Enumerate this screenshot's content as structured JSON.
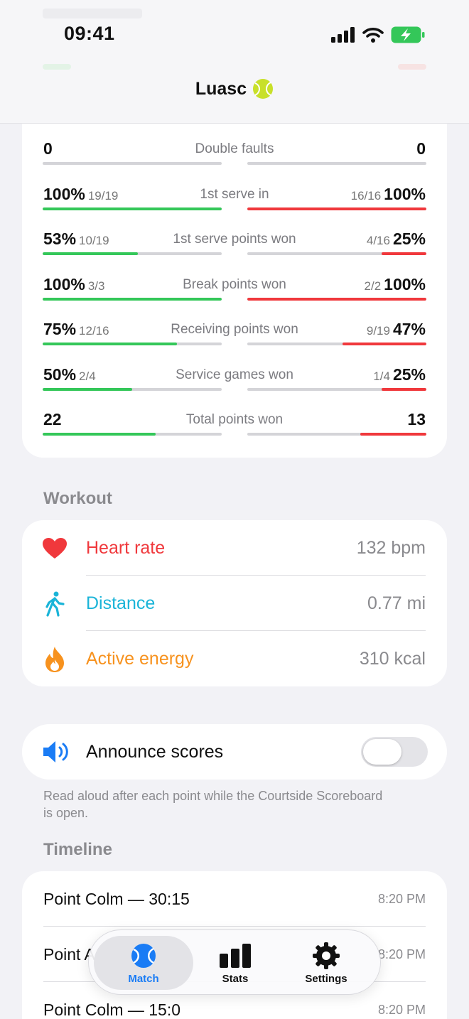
{
  "status_bar": {
    "time": "09:41"
  },
  "nav": {
    "title": "Luasc"
  },
  "stats": [
    {
      "label": "Double faults",
      "left_value": "0",
      "left_detail": "",
      "right_value": "0",
      "right_detail": "",
      "left_fraction": 0,
      "right_fraction": 0
    },
    {
      "label": "1st serve in",
      "left_value": "100%",
      "left_detail": "19/19",
      "right_value": "100%",
      "right_detail": "16/16",
      "left_fraction": 1.0,
      "right_fraction": 1.0
    },
    {
      "label": "1st serve points won",
      "left_value": "53%",
      "left_detail": "10/19",
      "right_value": "25%",
      "right_detail": "4/16",
      "left_fraction": 0.53,
      "right_fraction": 0.25
    },
    {
      "label": "Break points won",
      "left_value": "100%",
      "left_detail": "3/3",
      "right_value": "100%",
      "right_detail": "2/2",
      "left_fraction": 1.0,
      "right_fraction": 1.0
    },
    {
      "label": "Receiving points won",
      "left_value": "75%",
      "left_detail": "12/16",
      "right_value": "47%",
      "right_detail": "9/19",
      "left_fraction": 0.75,
      "right_fraction": 0.47
    },
    {
      "label": "Service games won",
      "left_value": "50%",
      "left_detail": "2/4",
      "right_value": "25%",
      "right_detail": "1/4",
      "left_fraction": 0.5,
      "right_fraction": 0.25
    },
    {
      "label": "Total points won",
      "left_value": "22",
      "left_detail": "",
      "right_value": "13",
      "right_detail": "",
      "left_fraction": 0.63,
      "right_fraction": 0.37
    }
  ],
  "workout": {
    "title": "Workout",
    "items": [
      {
        "label": "Heart rate",
        "value": "132 bpm",
        "icon": "heart-icon",
        "color": "#f0383c"
      },
      {
        "label": "Distance",
        "value": "0.77 mi",
        "icon": "walking-figure-icon",
        "color": "#1ab4d8"
      },
      {
        "label": "Active energy",
        "value": "310 kcal",
        "icon": "flame-icon",
        "color": "#f7921e"
      }
    ]
  },
  "announce": {
    "label": "Announce scores",
    "enabled": false,
    "footnote": "Read aloud after each point while the Courtside Scoreboard is open."
  },
  "timeline": {
    "title": "Timeline",
    "items": [
      {
        "label": "Point Colm — 30:15",
        "time": "8:20 PM"
      },
      {
        "label": "Point A",
        "time": "8:20 PM"
      },
      {
        "label": "Point Colm — 15:0",
        "time": "8:20 PM"
      }
    ]
  },
  "tab_bar": {
    "tabs": [
      {
        "label": "Match",
        "icon": "tennis-ball-icon",
        "active": true
      },
      {
        "label": "Stats",
        "icon": "bar-chart-icon",
        "active": false
      },
      {
        "label": "Settings",
        "icon": "gear-icon",
        "active": false
      }
    ]
  },
  "colors": {
    "accent": "#1a7cf5",
    "player_left": "#34c759",
    "player_right": "#f0383c"
  }
}
